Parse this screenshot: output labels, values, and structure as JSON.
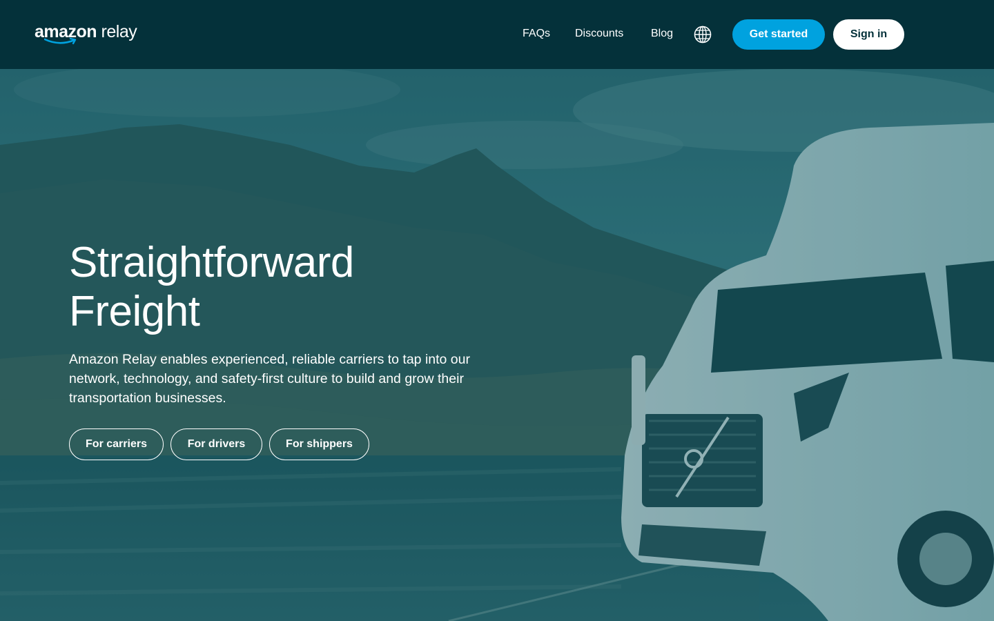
{
  "brand": {
    "logo_word1": "amazon",
    "logo_word2": " relay"
  },
  "nav": {
    "faqs": "FAQs",
    "discounts": "Discounts",
    "blog": "Blog",
    "globe_icon": "globe-icon",
    "get_started": "Get started",
    "sign_in": "Sign in"
  },
  "hero": {
    "title_line1": "Straightforward",
    "title_line2": "Freight",
    "description": "Amazon Relay enables experienced, reliable carriers to tap into our network, technology, and safety-first culture to build and grow their transportation businesses.",
    "buttons": [
      "For carriers",
      "For drivers",
      "For shippers"
    ]
  },
  "colors": {
    "header_bg": "#04313a",
    "accent": "#00a2df",
    "hero_tint": "#0d4b55"
  }
}
